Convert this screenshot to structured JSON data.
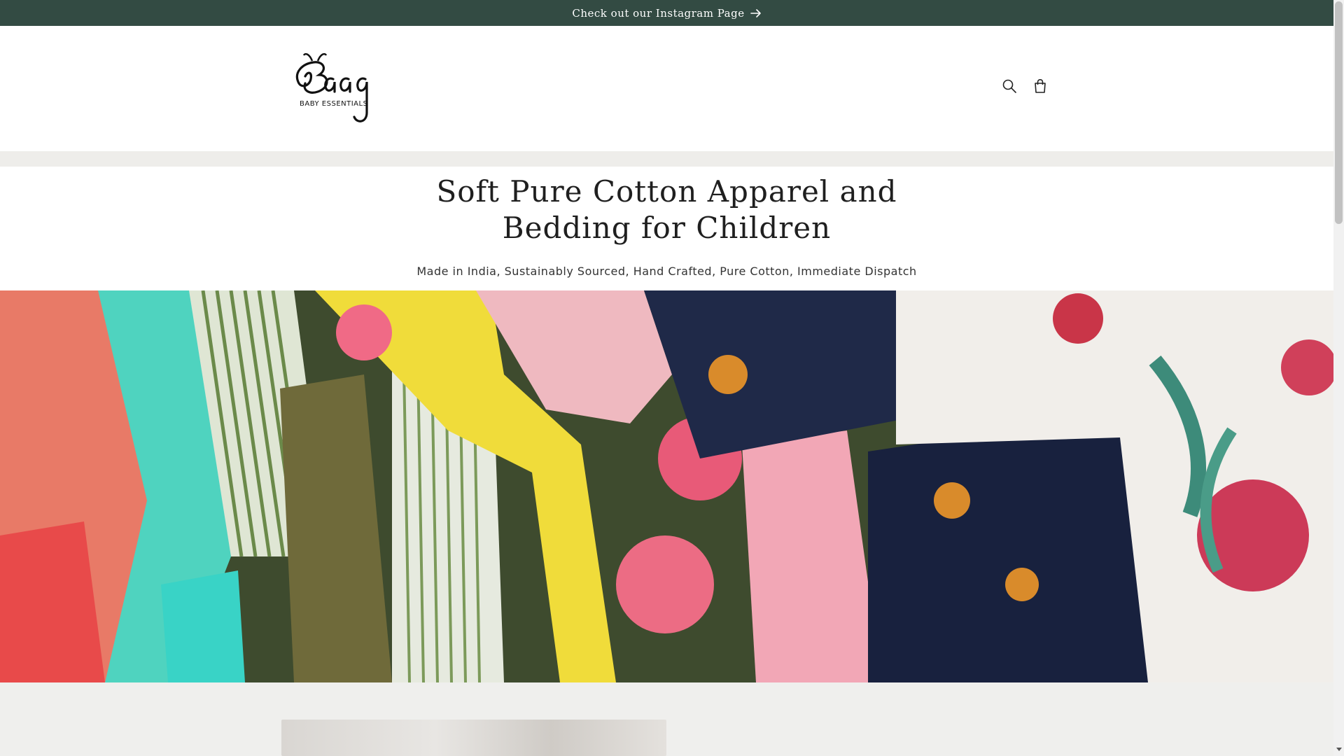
{
  "announcement": {
    "text": "Check out our Instagram Page",
    "arrow_icon": "arrow-right-icon"
  },
  "header": {
    "logo": {
      "brand": "Baag",
      "tagline": "BABY ESSENTIALS"
    },
    "icons": [
      "search-icon",
      "cart-icon"
    ]
  },
  "hero": {
    "title": "Soft Pure Cotton Apparel and Bedding for Children",
    "subtitle": "Made in India, Sustainably Sourced, Hand Crafted, Pure Cotton, Immediate Dispatch"
  },
  "colors": {
    "announcement_bg": "#334b43",
    "band": "#eeedea"
  }
}
